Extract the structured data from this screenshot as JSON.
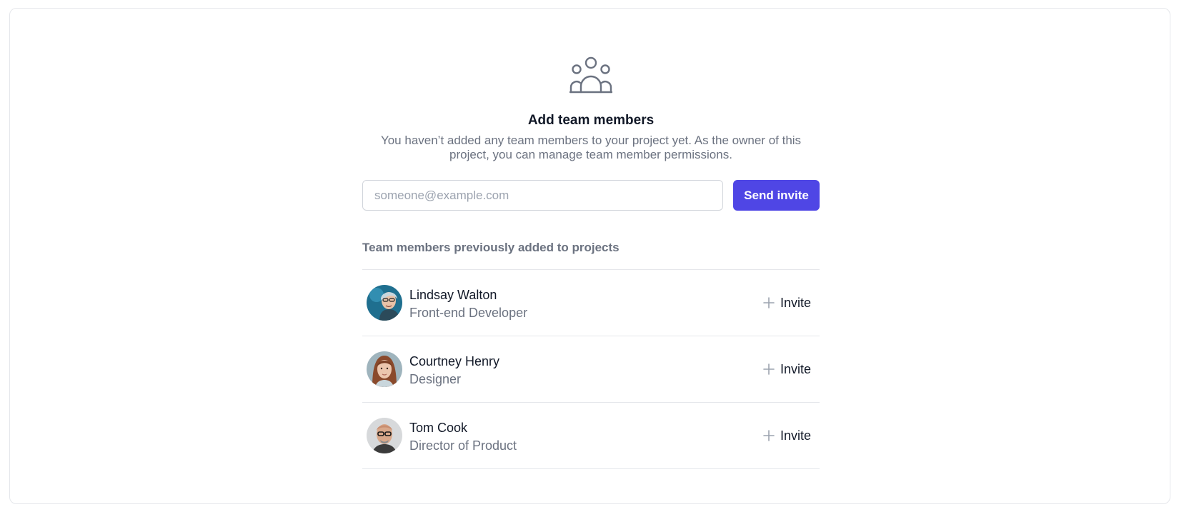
{
  "header": {
    "icon": "user-group-icon",
    "title": "Add team members",
    "description": "You haven’t added any team members to your project yet. As the owner of this project, you can manage team member permissions."
  },
  "invite_form": {
    "email_placeholder": "someone@example.com",
    "email_value": "",
    "send_label": "Send invite"
  },
  "previous_members": {
    "heading": "Team members previously added to projects",
    "members": [
      {
        "name": "Lindsay Walton",
        "role": "Front-end Developer",
        "invite_label": "Invite",
        "avatar_icon": "avatar-photo"
      },
      {
        "name": "Courtney Henry",
        "role": "Designer",
        "invite_label": "Invite",
        "avatar_icon": "avatar-photo"
      },
      {
        "name": "Tom Cook",
        "role": "Director of Product",
        "invite_label": "Invite",
        "avatar_icon": "avatar-photo"
      }
    ]
  },
  "colors": {
    "primary": "#4f46e5",
    "text_dark": "#111827",
    "text_muted": "#6b7280",
    "border": "#e5e7eb"
  }
}
